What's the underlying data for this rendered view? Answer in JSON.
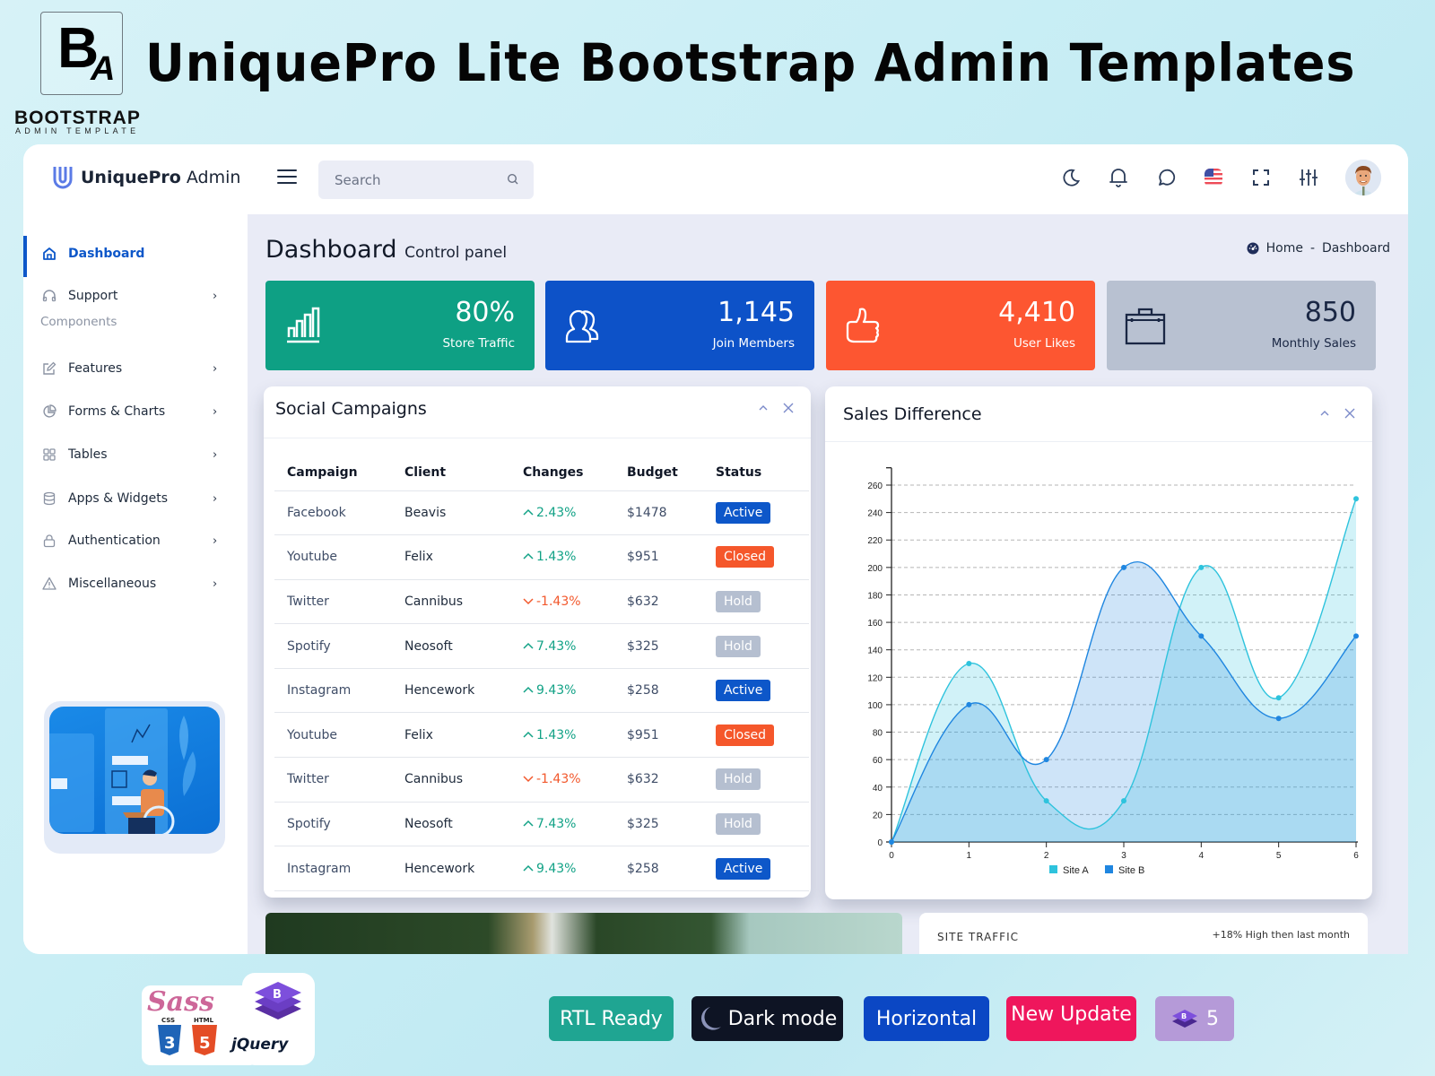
{
  "banner": {
    "logo_letters": "B",
    "logo_sub_letter": "A",
    "brand_word": "BOOTSTRAP",
    "brand_sub": "ADMIN TEMPLATE",
    "title": "UniquePro Lite Bootstrap Admin Templates"
  },
  "topbar": {
    "logo_bold": "UniquePro",
    "logo_light": " Admin",
    "search_placeholder": "Search",
    "icons": [
      "moon-icon",
      "bell-icon",
      "chat-icon",
      "us-flag-icon",
      "fullscreen-icon",
      "sliders-icon",
      "avatar"
    ]
  },
  "sidebar": {
    "items": [
      {
        "label": "Dashboard",
        "icon": "home-icon",
        "active": true
      },
      {
        "label": "Support",
        "icon": "headphones-icon",
        "chevron": "›"
      }
    ],
    "section_label": "Components",
    "component_items": [
      {
        "label": "Features",
        "icon": "edit-icon",
        "chevron": "›"
      },
      {
        "label": "Forms & Charts",
        "icon": "pie-chart-icon",
        "chevron": "›"
      },
      {
        "label": "Tables",
        "icon": "grid-icon",
        "chevron": "›"
      },
      {
        "label": "Apps & Widgets",
        "icon": "database-icon",
        "chevron": "›"
      },
      {
        "label": "Authentication",
        "icon": "lock-icon",
        "chevron": "›"
      },
      {
        "label": "Miscellaneous",
        "icon": "warning-icon",
        "chevron": "›"
      }
    ]
  },
  "page": {
    "title": "Dashboard",
    "subtitle": "Control panel",
    "breadcrumb": {
      "home": "Home",
      "separator": "-",
      "current": "Dashboard"
    }
  },
  "stats": [
    {
      "value": "80%",
      "label": "Store Traffic",
      "icon": "bar-chart-icon",
      "color": "#0ea084"
    },
    {
      "value": "1,145",
      "label": "Join Members",
      "icon": "users-icon",
      "color": "#0d52c8"
    },
    {
      "value": "4,410",
      "label": "User Likes",
      "icon": "thumbs-up-icon",
      "color": "#fd5631"
    },
    {
      "value": "850",
      "label": "Monthly Sales",
      "icon": "briefcase-icon",
      "color": "#b8c1d1"
    }
  ],
  "campaigns": {
    "title": "Social Campaigns",
    "columns": [
      "Campaign",
      "Client",
      "Changes",
      "Budget",
      "Status"
    ],
    "rows": [
      {
        "campaign": "Facebook",
        "client": "Beavis",
        "change": "2.43%",
        "direction": "up",
        "budget": "$1478",
        "status": "Active"
      },
      {
        "campaign": "Youtube",
        "client": "Felix",
        "change": "1.43%",
        "direction": "up",
        "budget": "$951",
        "status": "Closed"
      },
      {
        "campaign": "Twitter",
        "client": "Cannibus",
        "change": "-1.43%",
        "direction": "down",
        "budget": "$632",
        "status": "Hold"
      },
      {
        "campaign": "Spotify",
        "client": "Neosoft",
        "change": "7.43%",
        "direction": "up",
        "budget": "$325",
        "status": "Hold"
      },
      {
        "campaign": "Instagram",
        "client": "Hencework",
        "change": "9.43%",
        "direction": "up",
        "budget": "$258",
        "status": "Active"
      },
      {
        "campaign": "Youtube",
        "client": "Felix",
        "change": "1.43%",
        "direction": "up",
        "budget": "$951",
        "status": "Closed"
      },
      {
        "campaign": "Twitter",
        "client": "Cannibus",
        "change": "-1.43%",
        "direction": "down",
        "budget": "$632",
        "status": "Hold"
      },
      {
        "campaign": "Spotify",
        "client": "Neosoft",
        "change": "7.43%",
        "direction": "up",
        "budget": "$325",
        "status": "Hold"
      },
      {
        "campaign": "Instagram",
        "client": "Hencework",
        "change": "9.43%",
        "direction": "up",
        "budget": "$258",
        "status": "Active"
      }
    ]
  },
  "sales_card": {
    "title": "Sales Difference"
  },
  "chart_data": {
    "type": "area",
    "title": "Sales Difference",
    "x": [
      0,
      1,
      2,
      3,
      4,
      5,
      6
    ],
    "xlim": [
      0,
      6
    ],
    "ylim": [
      0,
      270
    ],
    "yticks": [
      0,
      20,
      40,
      60,
      80,
      100,
      120,
      140,
      160,
      180,
      200,
      220,
      240,
      260
    ],
    "grid": true,
    "legend": "bottom-center",
    "series": [
      {
        "name": "Site A",
        "values": [
          0,
          130,
          30,
          30,
          200,
          105,
          250
        ],
        "color": "#2ec3dd"
      },
      {
        "name": "Site B",
        "values": [
          0,
          100,
          60,
          200,
          150,
          90,
          150
        ],
        "color": "#1f86e0"
      }
    ]
  },
  "bottom_cards": {
    "traffic_title": "SITE TRAFFIC",
    "traffic_note": "+18% High then last month"
  },
  "features": [
    {
      "label": "RTL Ready",
      "color": "#1fa592"
    },
    {
      "label": "Dark mode",
      "color": "#0e1424"
    },
    {
      "label": "Horizontal",
      "color": "#0b47c4"
    },
    {
      "label": "New Update",
      "color": "#ef165c"
    },
    {
      "label": "5",
      "color": "#b59ad8"
    }
  ],
  "tech_logos": [
    "Sass",
    "CSS3",
    "HTML5",
    "Bootstrap",
    "jQuery"
  ],
  "tech_text": {
    "css": "CSS",
    "html": "HTML",
    "jquery": "jQuery"
  }
}
